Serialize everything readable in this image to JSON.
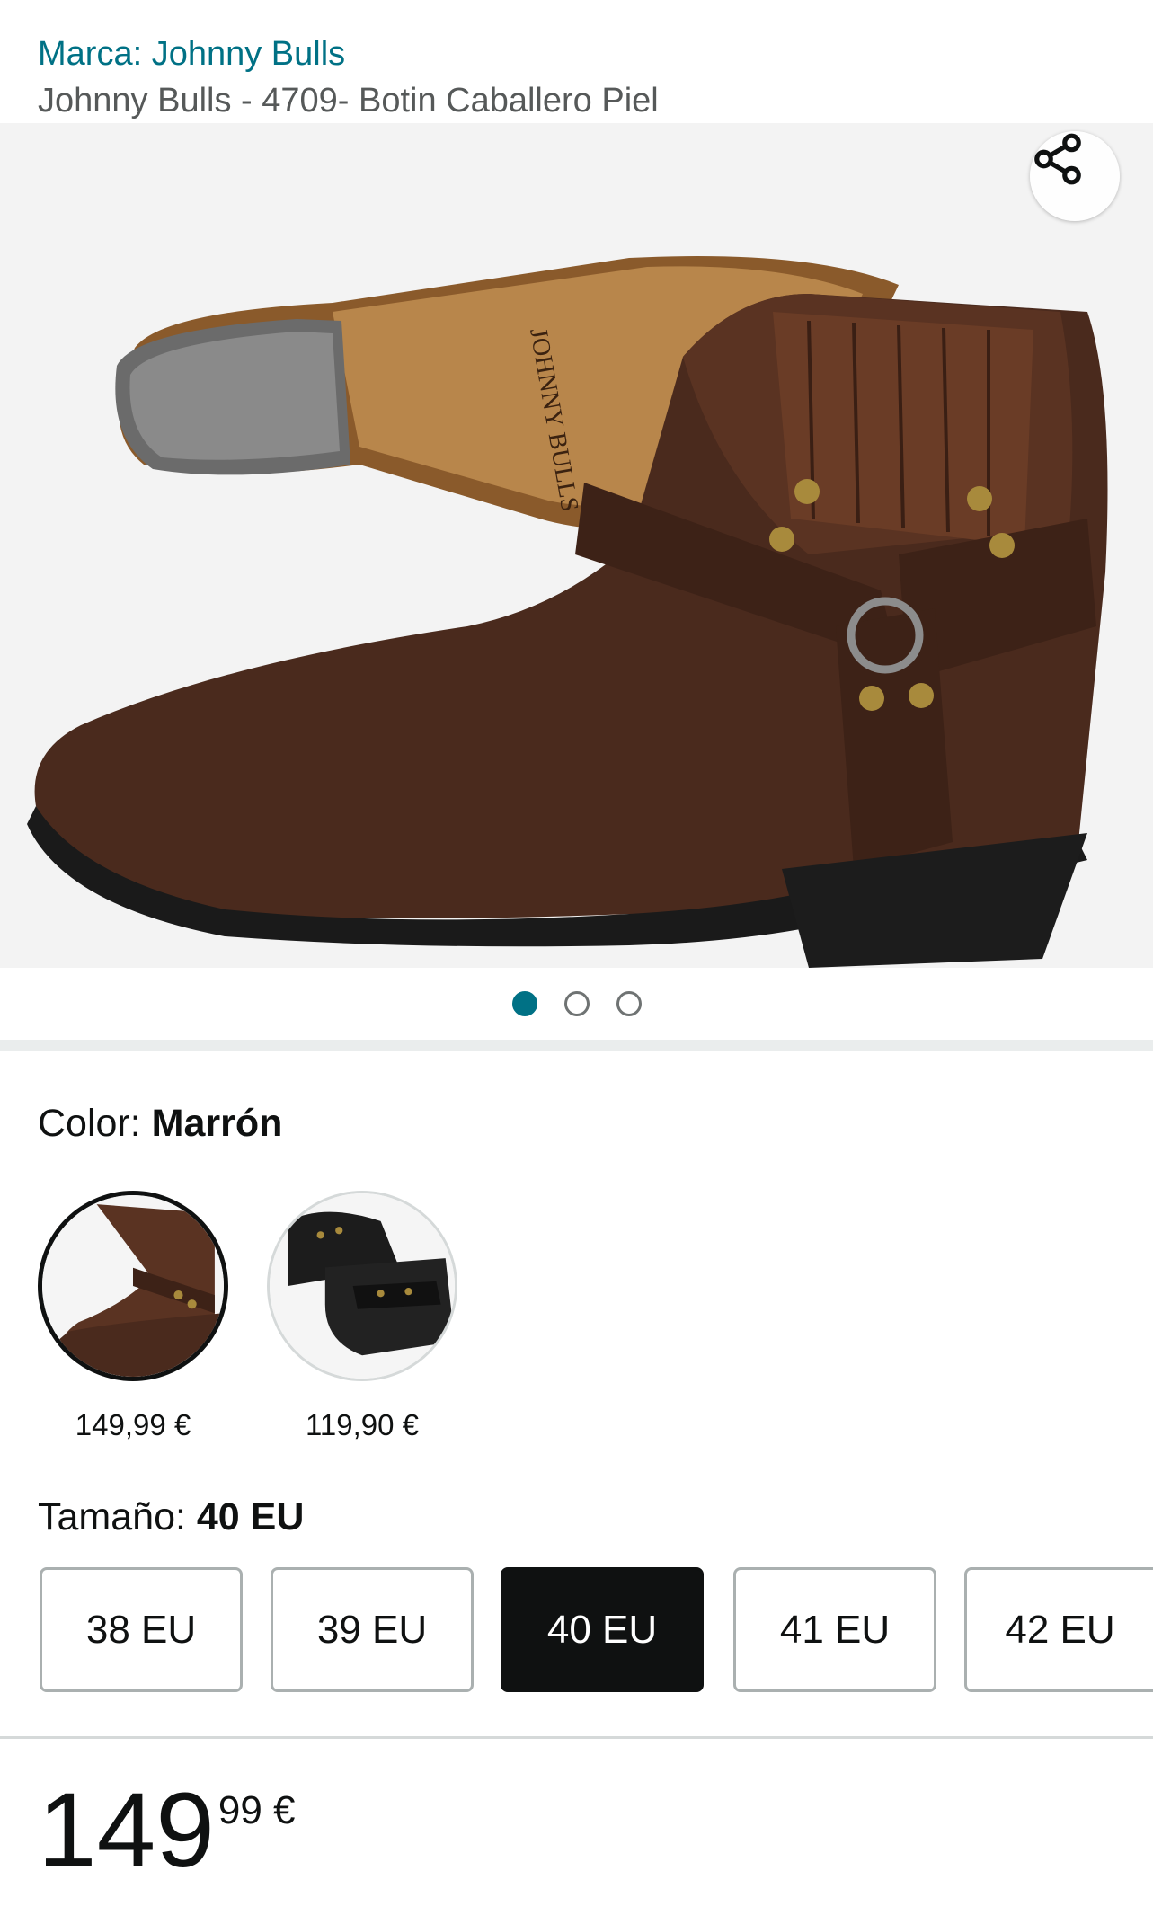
{
  "header": {
    "brand": "Marca: Johnny Bulls",
    "title": "Johnny Bulls - 4709- Botin Caballero Piel"
  },
  "gallery": {
    "image_count": 3,
    "active_index": 0,
    "share_icon": "share-icon"
  },
  "color": {
    "label": "Color:",
    "selected": "Marrón",
    "options": [
      {
        "name": "Marrón",
        "price": "149,99 €",
        "selected": true
      },
      {
        "name": "Negro",
        "price": "119,90 €",
        "selected": false
      }
    ]
  },
  "size": {
    "label": "Tamaño:",
    "selected": "40 EU",
    "options": [
      "38 EU",
      "39 EU",
      "40 EU",
      "41 EU",
      "42 EU"
    ]
  },
  "price": {
    "whole": "149",
    "fraction": "99 €"
  },
  "colors": {
    "link": "#007185",
    "text": "#0f1111",
    "selected_bg": "#0f1111"
  }
}
